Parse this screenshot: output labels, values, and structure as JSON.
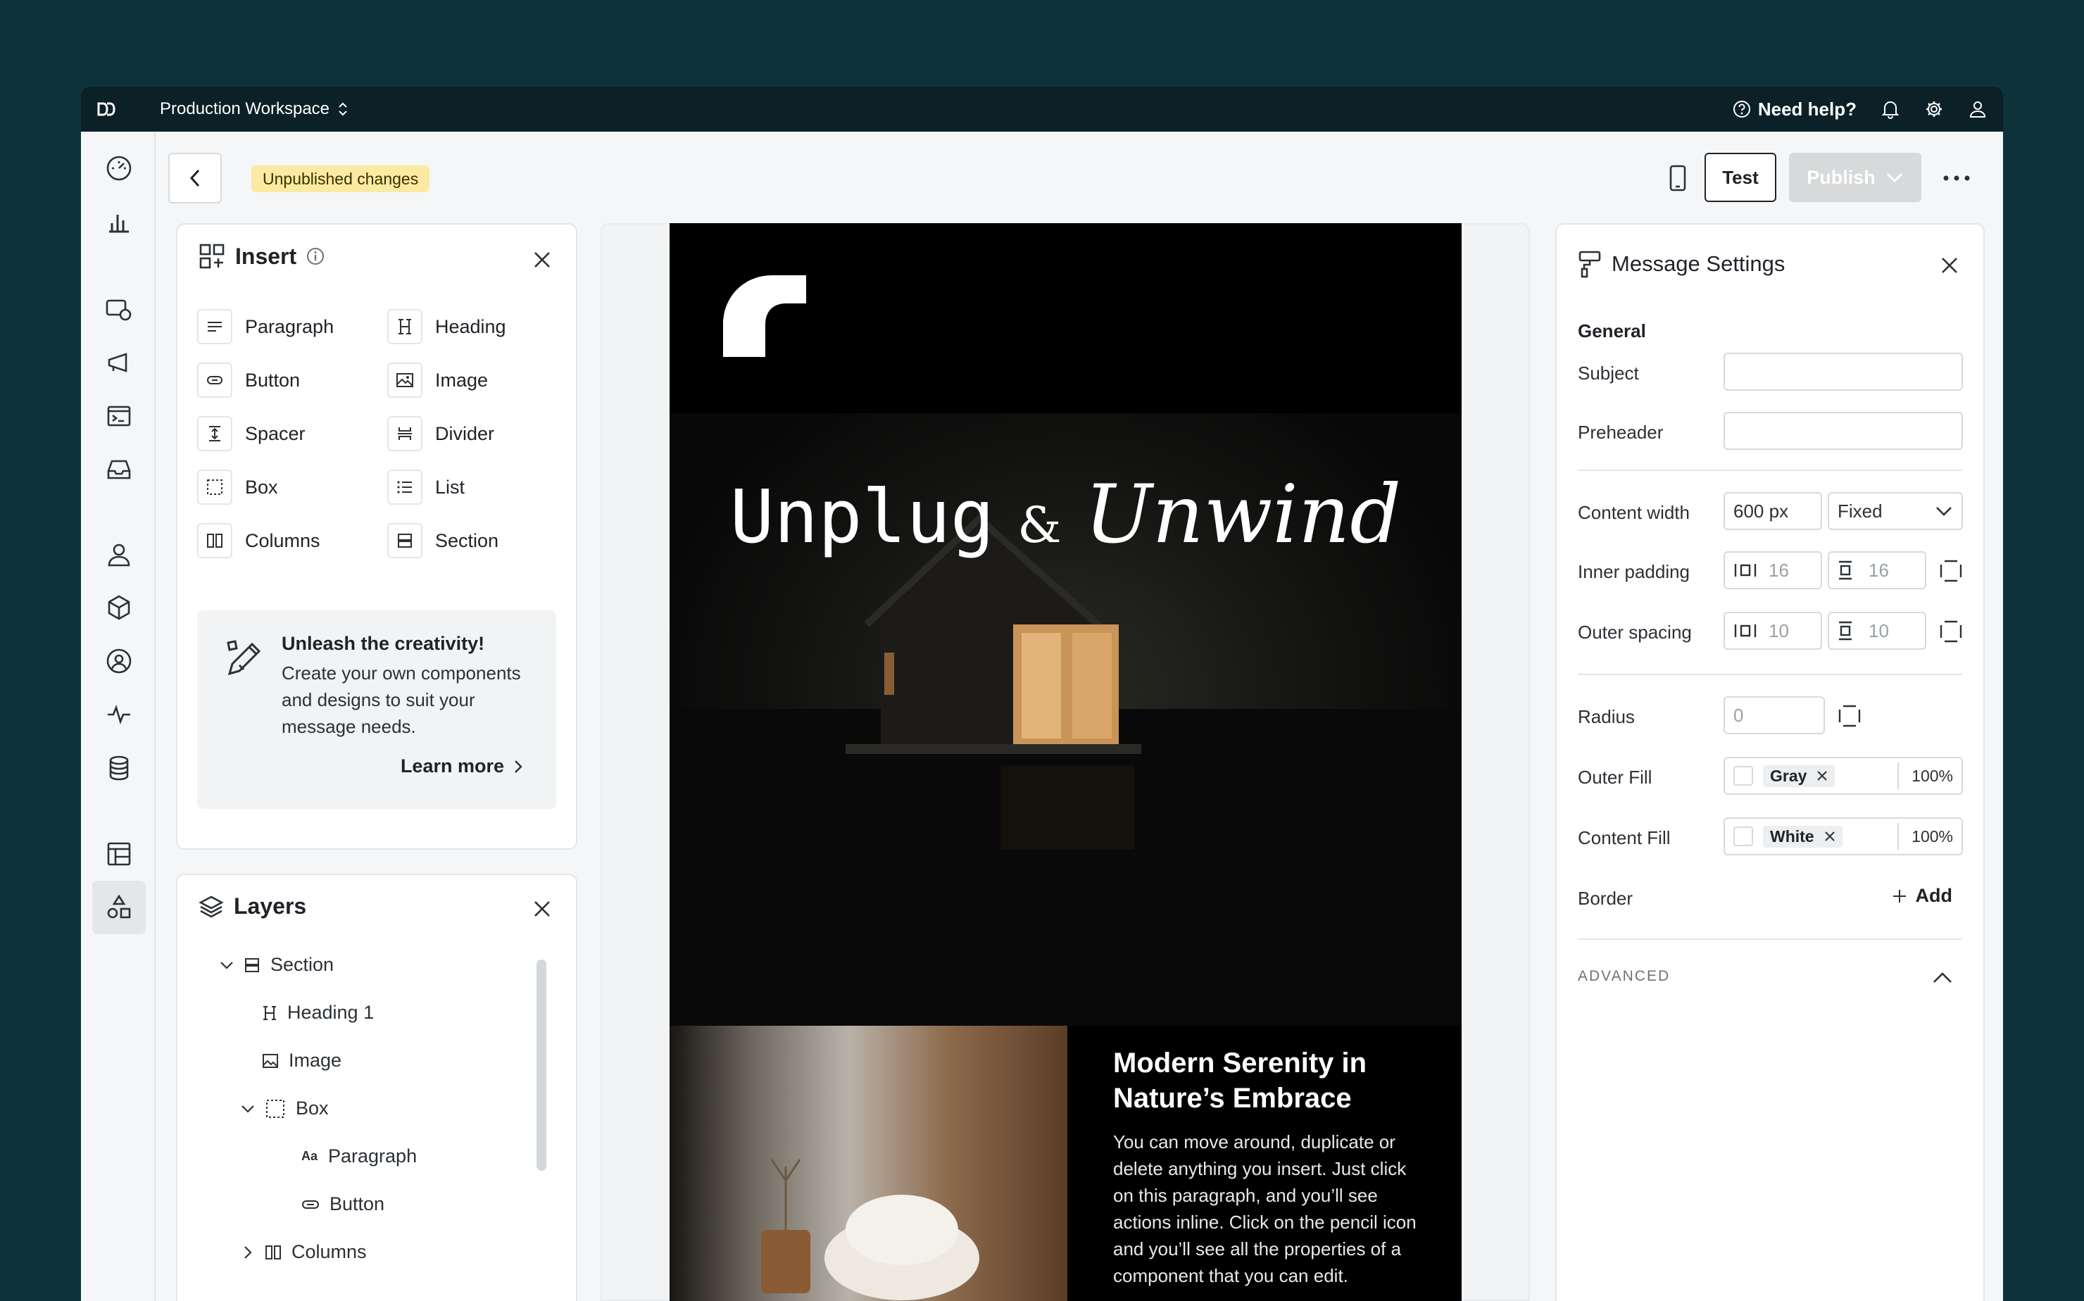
{
  "topbar": {
    "workspace": "Production Workspace",
    "help": "Need help?"
  },
  "actionbar": {
    "status_badge": "Unpublished changes",
    "test_label": "Test",
    "publish_label": "Publish"
  },
  "insert": {
    "title": "Insert",
    "items": [
      {
        "label": "Paragraph",
        "icon": "paragraph-icon"
      },
      {
        "label": "Heading",
        "icon": "heading-icon"
      },
      {
        "label": "Button",
        "icon": "button-icon"
      },
      {
        "label": "Image",
        "icon": "image-icon"
      },
      {
        "label": "Spacer",
        "icon": "spacer-icon"
      },
      {
        "label": "Divider",
        "icon": "divider-icon"
      },
      {
        "label": "Box",
        "icon": "box-icon"
      },
      {
        "label": "List",
        "icon": "list-icon"
      },
      {
        "label": "Columns",
        "icon": "columns-icon"
      },
      {
        "label": "Section",
        "icon": "section-icon"
      }
    ],
    "promo": {
      "title": "Unleash the creativity!",
      "text": "Create your own components and designs to suit your message needs.",
      "link": "Learn more"
    }
  },
  "layers": {
    "title": "Layers",
    "items": [
      {
        "label": "Section",
        "icon": "section-icon"
      },
      {
        "label": "Heading 1",
        "icon": "heading-icon"
      },
      {
        "label": "Image",
        "icon": "image-icon"
      },
      {
        "label": "Box",
        "icon": "box-icon"
      },
      {
        "label": "Paragraph",
        "icon": "text-icon"
      },
      {
        "label": "Button",
        "icon": "button-icon"
      },
      {
        "label": "Columns",
        "icon": "columns-icon"
      }
    ]
  },
  "email": {
    "headline_a": "Unplug",
    "headline_amp": "&",
    "headline_b": "Unwind",
    "section_title": "Modern Serenity in Nature’s Embrace",
    "section_body": "You can move around, duplicate or delete anything you insert. Just click on this paragraph, and you’ll see actions inline. Click on the pencil icon and you’ll see all the properties of a component that you can edit."
  },
  "settings": {
    "title": "Message Settings",
    "general": "General",
    "subject_label": "Subject",
    "subject_value": "",
    "preheader_label": "Preheader",
    "preheader_value": "",
    "content_width_label": "Content width",
    "content_width_value": "600 px",
    "content_width_mode": "Fixed",
    "inner_padding_label": "Inner padding",
    "inner_padding_h": "16",
    "inner_padding_v": "16",
    "outer_spacing_label": "Outer spacing",
    "outer_spacing_h": "10",
    "outer_spacing_v": "10",
    "radius_label": "Radius",
    "radius_value": "0",
    "outer_fill_label": "Outer Fill",
    "outer_fill_color": "Gray",
    "outer_fill_opacity": "100%",
    "content_fill_label": "Content Fill",
    "content_fill_color": "White",
    "content_fill_opacity": "100%",
    "border_label": "Border",
    "border_add": "Add",
    "advanced": "ADVANCED"
  },
  "colors": {
    "background": "#0e3239",
    "topbar": "#0b2127",
    "badge": "#fbeaa1",
    "publish_disabled": "#d7d9db"
  }
}
